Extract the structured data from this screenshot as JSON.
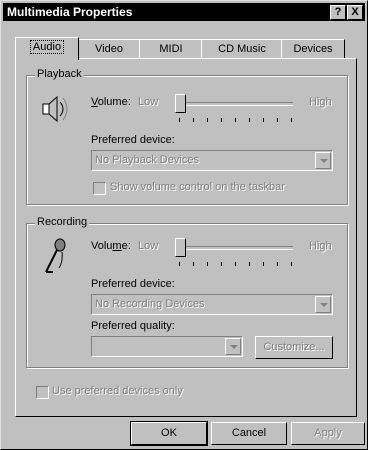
{
  "window": {
    "title": "Multimedia Properties",
    "help_label": "?",
    "close_label": "X"
  },
  "tabs": [
    {
      "label": "Audio",
      "active": true
    },
    {
      "label": "Video",
      "active": false
    },
    {
      "label": "MIDI",
      "active": false
    },
    {
      "label": "CD Music",
      "active": false
    },
    {
      "label": "Devices",
      "active": false
    }
  ],
  "playback": {
    "group_label": "Playback",
    "volume_label": "Volume:",
    "volume_mnemonic": "V",
    "volume_rest": "olume:",
    "low_label": "Low",
    "high_label": "High",
    "volume_level": 0,
    "preferred_device_label": "Preferred device:",
    "preferred_device_mnemonic": "d",
    "preferred_device_value": "No Playback Devices",
    "show_volume_label": "Show volume control on the taskbar",
    "show_volume_checked": false,
    "icon": "speaker-icon"
  },
  "recording": {
    "group_label": "Recording",
    "volume_label": "Volume:",
    "volume_pre": "Volu",
    "volume_mnemonic": "m",
    "volume_post": "e:",
    "low_label": "Low",
    "high_label": "High",
    "volume_level": 0,
    "preferred_device_label": "Preferred device:",
    "preferred_device_value": "No Recording Devices",
    "preferred_quality_label": "Preferred quality:",
    "preferred_quality_value": "",
    "customize_label": "Customize...",
    "icon": "microphone-icon"
  },
  "use_preferred_only_label": "Use preferred devices only",
  "use_preferred_only_checked": false,
  "buttons": {
    "ok": "OK",
    "cancel": "Cancel",
    "apply": "Apply"
  }
}
